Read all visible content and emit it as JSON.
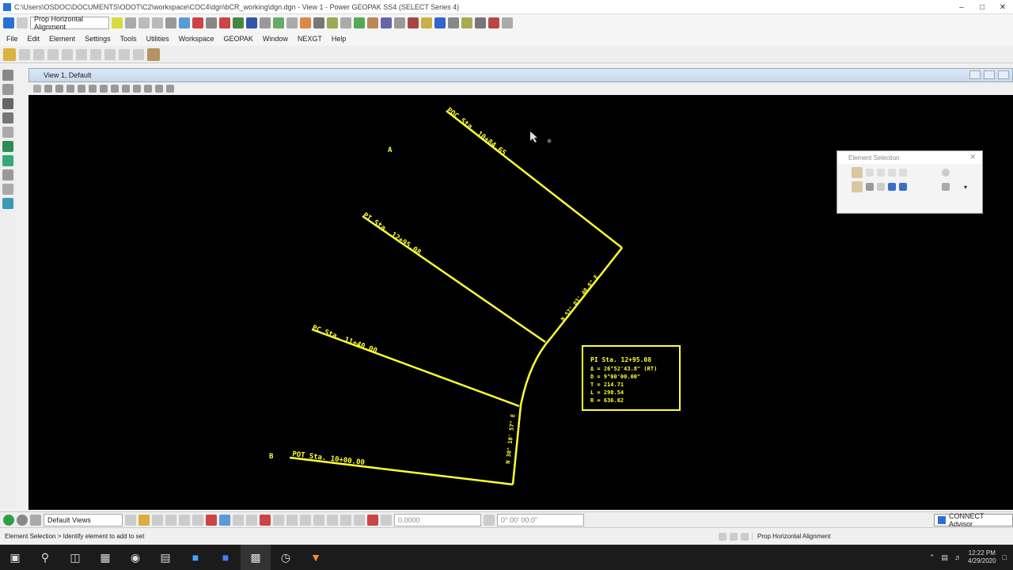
{
  "window": {
    "title": "C:\\Users\\OSDOC\\DOCUMENTS\\ODOT\\C2\\workspace\\COC4\\dgn\\bCR_working\\dgn.dgn - View 1 - Power GEOPAK SS4 (SELECT Series 4)",
    "minimize": "–",
    "maximize": "□",
    "close": "✕"
  },
  "toolbar": {
    "task_combo": "Prop Horizontal Alignment"
  },
  "menu": {
    "items": [
      "File",
      "Edit",
      "Element",
      "Settings",
      "Tools",
      "Utilities",
      "Workspace",
      "GEOPAK",
      "Window",
      "NEXGT",
      "Help"
    ]
  },
  "view": {
    "title": "View 1, Default"
  },
  "canvas": {
    "labels": {
      "poc_top": "POC Sta. 10+84.65",
      "pi_mid": "PI Sta. 12+95.08",
      "pc_lower": "PC Sta. 11+40.00",
      "pot_bottom": "POT Sta. 10+00.00",
      "bearing_upper": "N 57° 03' 40.8\" E",
      "bearing_lower": "N 30° 10' 57\" E",
      "point_a": "A",
      "point_b": "B"
    },
    "curve_data": {
      "lines": [
        "PI Sta. 12+95.08",
        "Δ = 26°52'43.8\" (RT)",
        "D = 9°00'00.00\"",
        "T = 214.71",
        "L = 298.54",
        "R = 636.62"
      ]
    }
  },
  "float_panel": {
    "title": "Element Selection",
    "close": "✕"
  },
  "bottombar": {
    "views_combo": "Default Views",
    "field1": "0.0000",
    "field2": "0° 00' 00.0\"",
    "advisor": "CONNECT Advisor"
  },
  "status": {
    "message": "Element Selection > Identify element to add to set",
    "right": "Prop Horizontal Alignment"
  },
  "taskbar": {
    "time": "12:22 PM",
    "date": "4/29/2020"
  }
}
